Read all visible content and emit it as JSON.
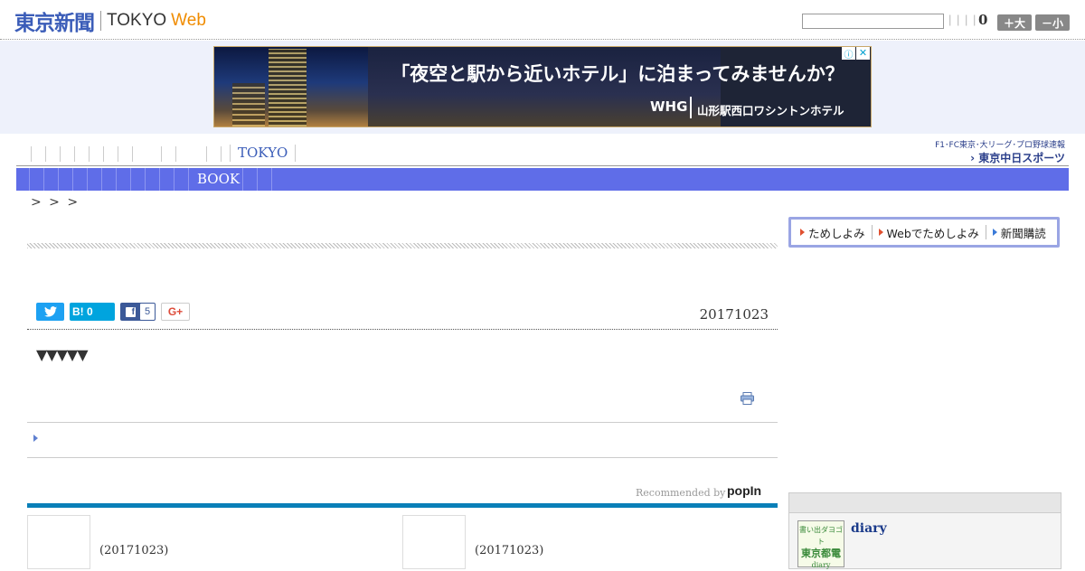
{
  "header": {
    "logo_jp": "東京新聞",
    "logo_en": "TOKYO",
    "logo_web": "Web",
    "mini_links": "| | | |",
    "count": "0",
    "size_large": "＋大",
    "size_small": "－小"
  },
  "ad": {
    "headline": "「夜空と駅から近いホテル」に泊まってみませんか？",
    "brand": "WHG",
    "hotel": "山形駅西口ワシントンホテル",
    "info": "ⓘ",
    "close": "✕"
  },
  "nav": {
    "tokyo": "TOKYO",
    "book": "BOOK",
    "chunichi_sub": "F1･FC東京･大リーグ･プロ野球速報",
    "chunichi_main": "› 東京中日スポーツ"
  },
  "breadcrumb": ">   > >",
  "article": {
    "date": "20171023",
    "triangles": "▼▼▼▼▼",
    "share_hatena": "B! 0",
    "share_fb_count": "5",
    "share_gplus": "G+"
  },
  "recommend": {
    "label": "Recommended by",
    "brand": "popIn",
    "items": [
      {
        "date": "(20171023)"
      },
      {
        "date": "(20171023)"
      }
    ]
  },
  "sidebar": {
    "subscription": [
      "ためしよみ",
      "Webでためしよみ",
      "新聞購読"
    ],
    "diary_title": "diary",
    "diary_img_top": "書い出ダヨゴト",
    "diary_img_main": "東京都電",
    "diary_img_bottom": "diary"
  },
  "colors": {
    "brand_blue": "#3a5cb8",
    "nav_bar": "#5f6de8",
    "accent_orange": "#f08c00",
    "rec_bar": "#0a7fb8"
  }
}
